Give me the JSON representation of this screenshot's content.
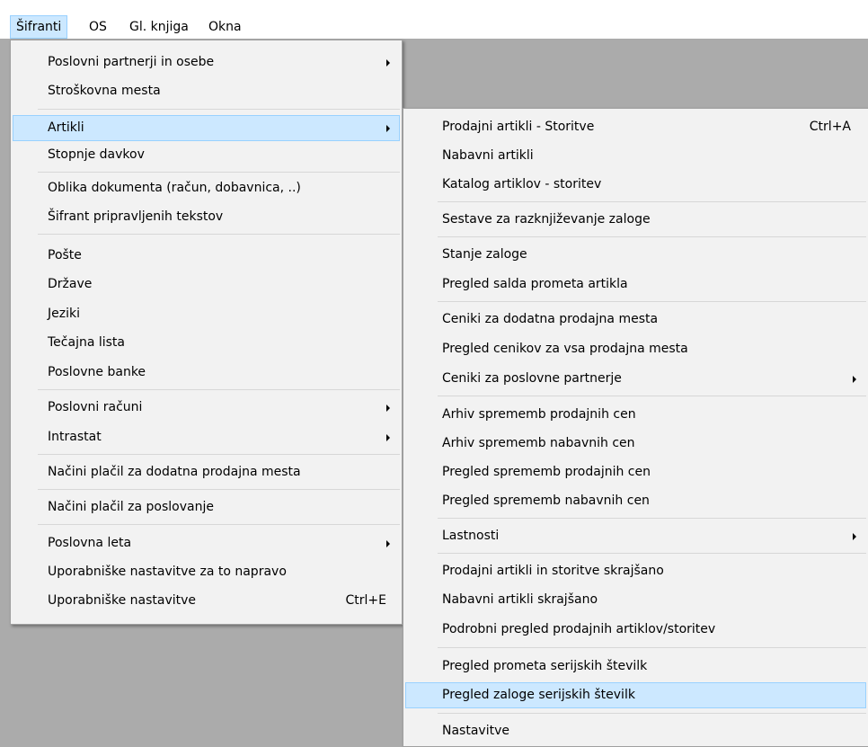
{
  "menubar": {
    "items": [
      {
        "label": "Šifranti"
      },
      {
        "label": "OS"
      },
      {
        "label": "Gl. knjiga"
      },
      {
        "label": "Okna"
      }
    ]
  },
  "main_menu": {
    "items": [
      {
        "label": "Poslovni partnerji in osebe"
      },
      {
        "label": "Stroškovna mesta"
      },
      {
        "label": "Artikli"
      },
      {
        "label": "Stopnje davkov"
      },
      {
        "label": "Oblika dokumenta (račun, dobavnica, ..)"
      },
      {
        "label": "Šifrant pripravljenih tekstov"
      },
      {
        "label": "Pošte"
      },
      {
        "label": "Države"
      },
      {
        "label": "Jeziki"
      },
      {
        "label": "Tečajna lista"
      },
      {
        "label": "Poslovne banke"
      },
      {
        "label": "Poslovni računi"
      },
      {
        "label": "Intrastat"
      },
      {
        "label": "Načini plačil za dodatna prodajna mesta"
      },
      {
        "label": "Načini plačil za poslovanje"
      },
      {
        "label": "Poslovna leta"
      },
      {
        "label": "Uporabniške nastavitve za to napravo"
      },
      {
        "label": "Uporabniške nastavitve",
        "shortcut": "Ctrl+E"
      }
    ]
  },
  "sub_menu": {
    "items": [
      {
        "label": "Prodajni artikli - Storitve",
        "shortcut": "Ctrl+A"
      },
      {
        "label": "Nabavni artikli"
      },
      {
        "label": "Katalog artiklov - storitev"
      },
      {
        "label": "Sestave za razknjiževanje zaloge"
      },
      {
        "label": "Stanje zaloge"
      },
      {
        "label": "Pregled salda prometa artikla"
      },
      {
        "label": "Ceniki za dodatna prodajna mesta"
      },
      {
        "label": "Pregled cenikov za vsa prodajna mesta"
      },
      {
        "label": "Ceniki za poslovne partnerje"
      },
      {
        "label": "Arhiv sprememb prodajnih cen"
      },
      {
        "label": "Arhiv sprememb nabavnih cen"
      },
      {
        "label": "Pregled sprememb prodajnih cen"
      },
      {
        "label": "Pregled sprememb nabavnih cen"
      },
      {
        "label": "Lastnosti"
      },
      {
        "label": "Prodajni artikli in storitve skrajšano"
      },
      {
        "label": "Nabavni artikli skrajšano"
      },
      {
        "label": "Podrobni pregled prodajnih artiklov/storitev"
      },
      {
        "label": "Pregled prometa serijskih številk"
      },
      {
        "label": "Pregled zaloge serijskih številk"
      },
      {
        "label": "Nastavitve"
      }
    ]
  },
  "colors": {
    "highlight_bg": "#cce8ff",
    "highlight_border": "#99d1ff",
    "menu_bg": "#f2f2f2",
    "workspace_bg": "#ababab"
  }
}
